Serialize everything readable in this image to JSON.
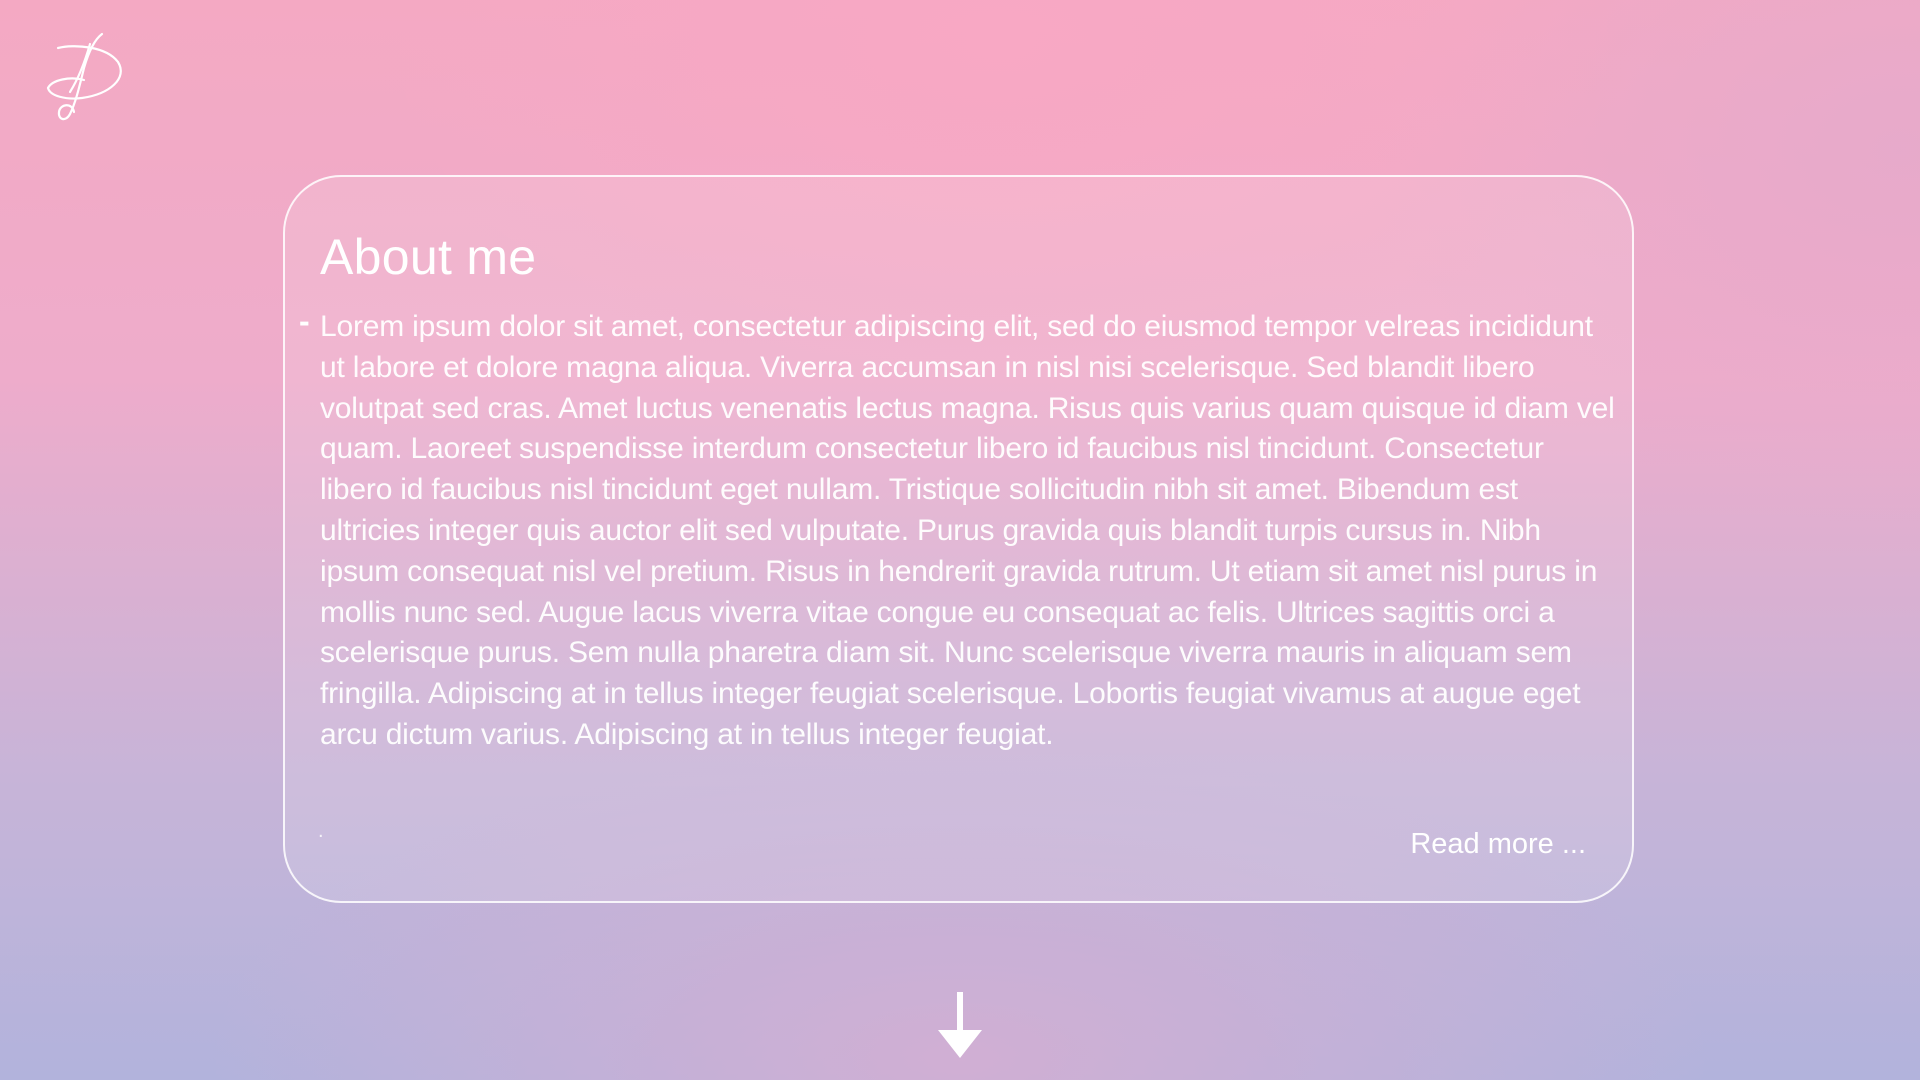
{
  "logo": {
    "icon": "signature-logo-icon"
  },
  "about": {
    "title": "About me",
    "bullet": "-",
    "text": "Lorem ipsum dolor sit amet, consectetur adipiscing elit, sed do eiusmod tempor velreas incididunt ut labore et dolore magna aliqua. Viverra accumsan in nisl nisi scelerisque. Sed blandit libero volutpat sed cras. Amet luctus venenatis lectus magna. Risus quis varius quam quisque id diam vel quam. Laoreet suspendisse interdum consectetur libero id faucibus nisl tincidunt. Consectetur libero id faucibus nisl tincidunt eget nullam. Tristique sollicitudin nibh sit amet. Bibendum est ultricies integer quis auctor elit sed vulputate. Purus gravida quis blandit turpis cursus in. Nibh ipsum consequat nisl vel pretium. Risus in hendrerit gravida rutrum. Ut etiam sit amet nisl purus in mollis nunc sed. Augue lacus viverra vitae congue eu consequat ac felis. Ultrices sagittis orci a scelerisque purus. Sem nulla pharetra diam sit. Nunc scelerisque viverra mauris in aliquam sem fringilla. Adipiscing at in tellus integer feugiat scelerisque. Lobortis feugiat vivamus at augue eget arcu dictum varius. Adipiscing at in tellus integer feugiat.",
    "trailing_mark": ".",
    "read_more_label": "Read more ..."
  },
  "scroll_indicator": {
    "icon": "arrow-down-icon"
  },
  "colors": {
    "background_top": "#f4a9c3",
    "background_bottom": "#b2b3dc",
    "text": "#ffffff",
    "card_border": "#ffffff"
  }
}
